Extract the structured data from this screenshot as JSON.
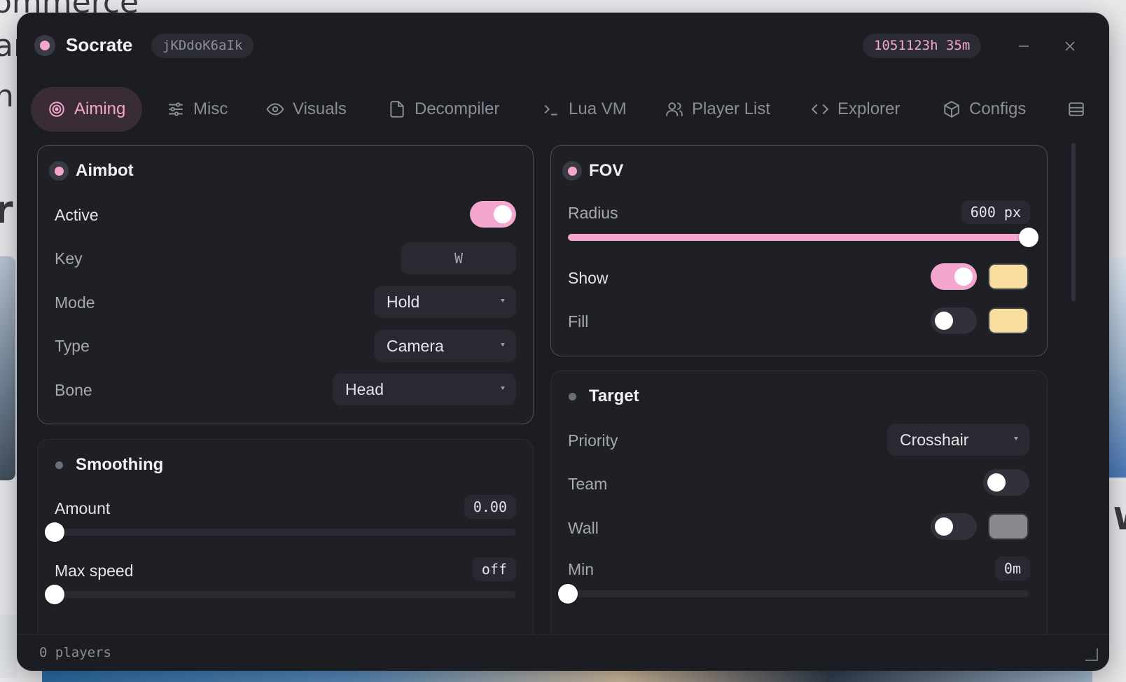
{
  "window": {
    "title": "Socrate",
    "session_id": "jKDdoK6aIk",
    "uptime": "1051123h 35m"
  },
  "tabs": [
    {
      "label": "Aiming",
      "icon": "target-icon",
      "active": true
    },
    {
      "label": "Misc",
      "icon": "sliders-icon"
    },
    {
      "label": "Visuals",
      "icon": "eye-icon"
    },
    {
      "label": "Decompiler",
      "icon": "file-icon"
    },
    {
      "label": "Lua VM",
      "icon": "terminal-icon"
    },
    {
      "label": "Player List",
      "icon": "users-icon"
    },
    {
      "label": "Explorer",
      "icon": "code-icon"
    },
    {
      "label": "Configs",
      "icon": "box-icon"
    }
  ],
  "aimbot": {
    "title": "Aimbot",
    "active_label": "Active",
    "active": true,
    "key_label": "Key",
    "key_value": "W",
    "mode_label": "Mode",
    "mode_value": "Hold",
    "type_label": "Type",
    "type_value": "Camera",
    "bone_label": "Bone",
    "bone_value": "Head"
  },
  "smoothing": {
    "title": "Smoothing",
    "amount_label": "Amount",
    "amount_value": "0.00",
    "amount_fraction": 0,
    "max_speed_label": "Max speed",
    "max_speed_value": "off",
    "max_speed_fraction": 0
  },
  "fov": {
    "title": "FOV",
    "radius_label": "Radius",
    "radius_value": "600 px",
    "radius_fraction": 1,
    "show_label": "Show",
    "show": true,
    "show_color": "#f8dca0",
    "fill_label": "Fill",
    "fill": false,
    "fill_color": "#f8dca0"
  },
  "target": {
    "title": "Target",
    "priority_label": "Priority",
    "priority_value": "Crosshair",
    "team_label": "Team",
    "team": false,
    "wall_label": "Wall",
    "wall": false,
    "wall_color": "#8a8a8e",
    "min_label": "Min",
    "min_value": "0m",
    "min_fraction": 0
  },
  "status": {
    "text": "0 players"
  },
  "colors": {
    "accent": "#f4a6cf",
    "background": "#1c1d22"
  }
}
